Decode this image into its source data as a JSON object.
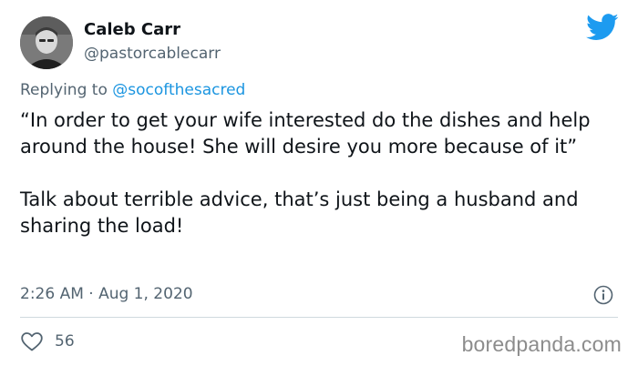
{
  "author": {
    "display_name": "Caleb Carr",
    "handle": "@pastorcablecarr"
  },
  "reply": {
    "prefix": "Replying to ",
    "mention": "@socofthesacred"
  },
  "tweet": {
    "paragraph_1": "“In order to get your wife interested do the dishes and help around the house! She will desire you more because of it”",
    "paragraph_2": "Talk about terrible advice, that’s just being a husband and sharing the load!"
  },
  "meta": {
    "timestamp": "2:26 AM · Aug 1, 2020"
  },
  "actions": {
    "like_count": "56"
  },
  "watermark": "boredpanda.com",
  "icons": {
    "brand": "twitter-bird-icon",
    "info": "info-icon",
    "like": "heart-icon"
  },
  "colors": {
    "twitter_blue": "#1d9bf0",
    "mention_blue": "#1b95e0",
    "secondary_text": "#536471",
    "primary_text": "#0f1419",
    "divider": "#cfd9de"
  }
}
